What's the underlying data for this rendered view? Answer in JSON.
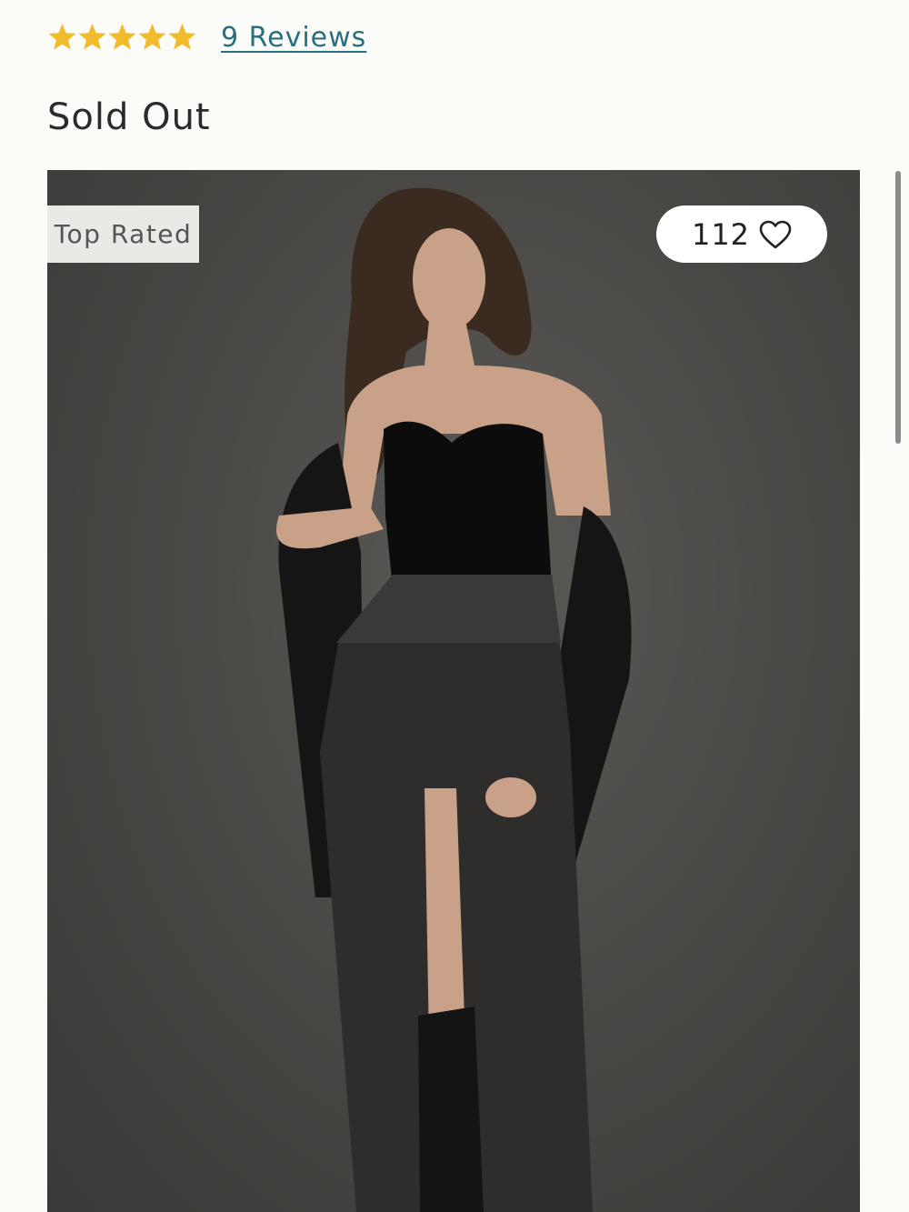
{
  "rating": {
    "stars": 5,
    "max_stars": 5,
    "star_color": "#f2bb2c",
    "reviews_label": "9 Reviews",
    "link_color": "#2a6f7f"
  },
  "product": {
    "stock_status": "Sold Out",
    "badge_label": "Top Rated",
    "likes_count": "112",
    "like_icon": "heart-outline-icon"
  }
}
